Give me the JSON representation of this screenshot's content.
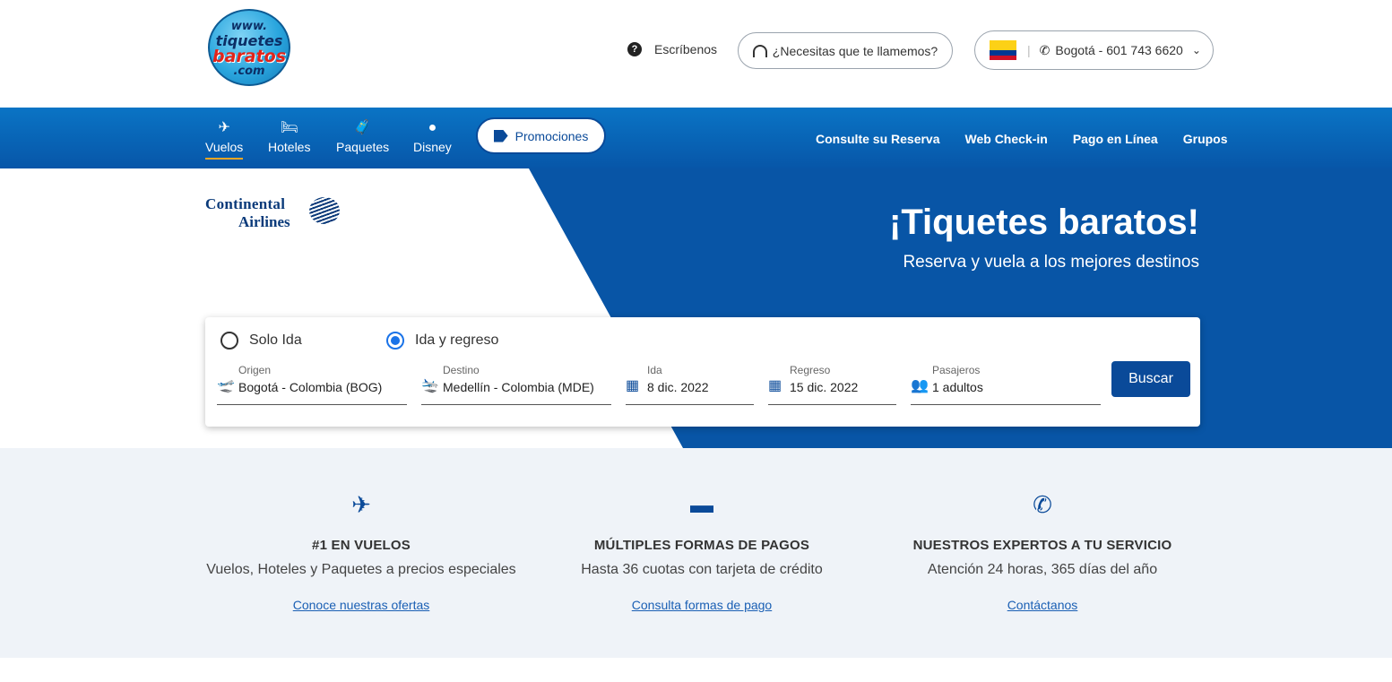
{
  "header": {
    "logo": {
      "line1": "www.",
      "line2": "tiquetes",
      "line3": "baratos",
      "line4": ".com"
    },
    "help_label": "Escríbenos",
    "call_button": "¿Necesitas que te llamemos?",
    "phone": "Bogotá - 601 743 6620"
  },
  "nav": {
    "items": [
      {
        "label": "Vuelos",
        "icon": "plane-icon",
        "glyph": "✈"
      },
      {
        "label": "Hoteles",
        "icon": "bed-icon",
        "glyph": "🛏"
      },
      {
        "label": "Paquetes",
        "icon": "luggage-icon",
        "glyph": "🧳"
      },
      {
        "label": "Disney",
        "icon": "mickey-icon",
        "glyph": "●"
      }
    ],
    "promo": "Promociones",
    "links": [
      "Consulte su Reserva",
      "Web Check-in",
      "Pago en Línea",
      "Grupos"
    ]
  },
  "hero": {
    "airline_line1": "Continental",
    "airline_line2": "Airlines",
    "title": "¡Tiquetes baratos!",
    "subtitle": "Reserva y vuela a los mejores destinos"
  },
  "search": {
    "trip_types": [
      "Solo Ida",
      "Ida y regreso"
    ],
    "selected_trip": "Ida y regreso",
    "fields": {
      "origin": {
        "label": "Origen",
        "value": "Bogotá - Colombia (BOG)"
      },
      "destination": {
        "label": "Destino",
        "value": "Medellín - Colombia (MDE)"
      },
      "depart": {
        "label": "Ida",
        "value": "8 dic. 2022"
      },
      "return": {
        "label": "Regreso",
        "value": "15 dic. 2022"
      },
      "passengers": {
        "label": "Pasajeros",
        "value": "1 adultos"
      }
    },
    "button": "Buscar"
  },
  "features": [
    {
      "title": "#1 EN VUELOS",
      "desc": "Vuelos, Hoteles y Paquetes a precios especiales",
      "link": "Conoce nuestras ofertas",
      "icon": "plane-icon"
    },
    {
      "title": "MÚLTIPLES FORMAS DE PAGOS",
      "desc": "Hasta 36 cuotas con tarjeta de crédito",
      "link": "Consulta formas de pago",
      "icon": "credit-card-icon"
    },
    {
      "title": "NUESTROS EXPERTOS A TU SERVICIO",
      "desc": "Atención 24 horas, 365 días del año",
      "link": "Contáctanos",
      "icon": "phone-chat-icon"
    }
  ],
  "colors": {
    "primary": "#0a4a99",
    "nav_blue": "#0756a8",
    "accent_underline": "#f6a623"
  }
}
